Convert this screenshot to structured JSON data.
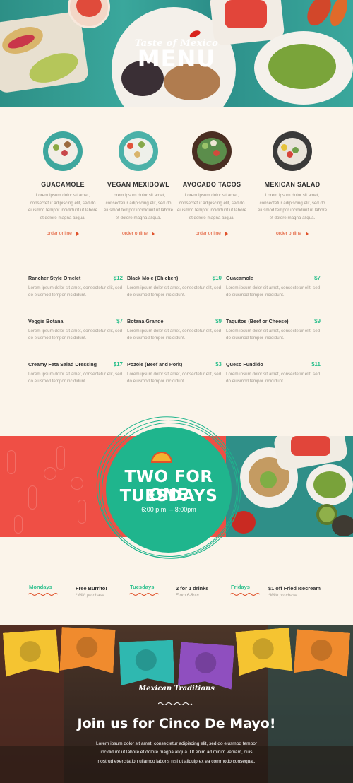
{
  "hero": {
    "brand": "Taste of Mexico",
    "title": "MENU"
  },
  "dishes": [
    {
      "name": "GUACAMOLE",
      "desc": "Lorem ipsum dolor sit amet, consectetur adipiscing elit, sed do eiusmod tempor incididunt ut labore et dolore magna aliqua.",
      "cta": "order online"
    },
    {
      "name": "VEGAN MEXIBOWL",
      "desc": "Lorem ipsum dolor sit amet, consectetur adipiscing elit, sed do eiusmod tempor incididunt ut labore et dolore magna aliqua.",
      "cta": "order online"
    },
    {
      "name": "AVOCADO TACOS",
      "desc": "Lorem ipsum dolor sit amet, consectetur adipiscing elit, sed do eiusmod tempor incididunt ut labore et dolore magna aliqua.",
      "cta": "order online"
    },
    {
      "name": "MEXICAN SALAD",
      "desc": "Lorem ipsum dolor sit amet, consectetur adipiscing elit, sed do eiusmod tempor incididunt ut labore et dolore magna aliqua.",
      "cta": "order online"
    }
  ],
  "menu_items": [
    {
      "name": "Rancher Style Omelet",
      "price": "$12",
      "desc": "Lorem ipsum dolor sit amet, consectetur elit, sed do eiusmod tempor incididunt."
    },
    {
      "name": "Black Mole (Chicken)",
      "price": "$10",
      "desc": "Lorem ipsum dolor sit amet, consectetur elit, sed do eiusmod tempor incididunt."
    },
    {
      "name": "Guacamole",
      "price": "$7",
      "desc": "Lorem ipsum dolor sit amet, consectetur elit, sed do eiusmod tempor incididunt."
    },
    {
      "name": "Veggie Botana",
      "price": "$7",
      "desc": "Lorem ipsum dolor sit amet, consectetur elit, sed do eiusmod tempor incididunt."
    },
    {
      "name": "Botana Grande",
      "price": "$9",
      "desc": "Lorem ipsum dolor sit amet, consectetur elit, sed do eiusmod tempor incididunt."
    },
    {
      "name": "Taquitos (Beef or Cheese)",
      "price": "$9",
      "desc": "Lorem ipsum dolor sit amet, consectetur elit, sed do eiusmod tempor incididunt."
    },
    {
      "name": "Creamy Feta Salad Dressing",
      "price": "$17",
      "desc": "Lorem ipsum dolor sit amet, consectetur elit, sed do eiusmod tempor incididunt."
    },
    {
      "name": "Pozole (Beef and Pork)",
      "price": "$3",
      "desc": "Lorem ipsum dolor sit amet, consectetur elit, sed do eiusmod tempor incididunt."
    },
    {
      "name": "Queso Fundido",
      "price": "$11",
      "desc": "Lorem ipsum dolor sit amet, consectetur elit, sed do eiusmod tempor incididunt."
    }
  ],
  "promo": {
    "line1": "TWO FOR ONE",
    "line2": "TUESDAYS",
    "time": "6:00 p.m. – 8:00pm"
  },
  "specials": [
    {
      "day": "Mondays",
      "deal": "Free Burrito!",
      "note": "*With purchase"
    },
    {
      "day": "Tuesdays",
      "deal": "2 for 1 drinks",
      "note": "From 6-8pm"
    },
    {
      "day": "Fridays",
      "deal": "$1 off Fried Icecream",
      "note": "*With purchase"
    }
  ],
  "event": {
    "kicker": "Mexican Traditions",
    "title": "Join us for Cinco De Mayo!",
    "text": "Lorem ipsum dolor sit amet, consectetur adipiscing elit, sed do eiusmod tempor incididunt ut labore et dolore magna aliqua. Ut enim ad minim veniam, quis nostrud exercitation ullamco laboris nisi ut aliquip ex ea commodo consequat."
  },
  "colors": {
    "accent_green": "#2bbf8c",
    "accent_orange": "#e0512a",
    "promo_red": "#ef4f45",
    "promo_circle": "#1fb58d",
    "page_bg": "#fbf4ea"
  }
}
